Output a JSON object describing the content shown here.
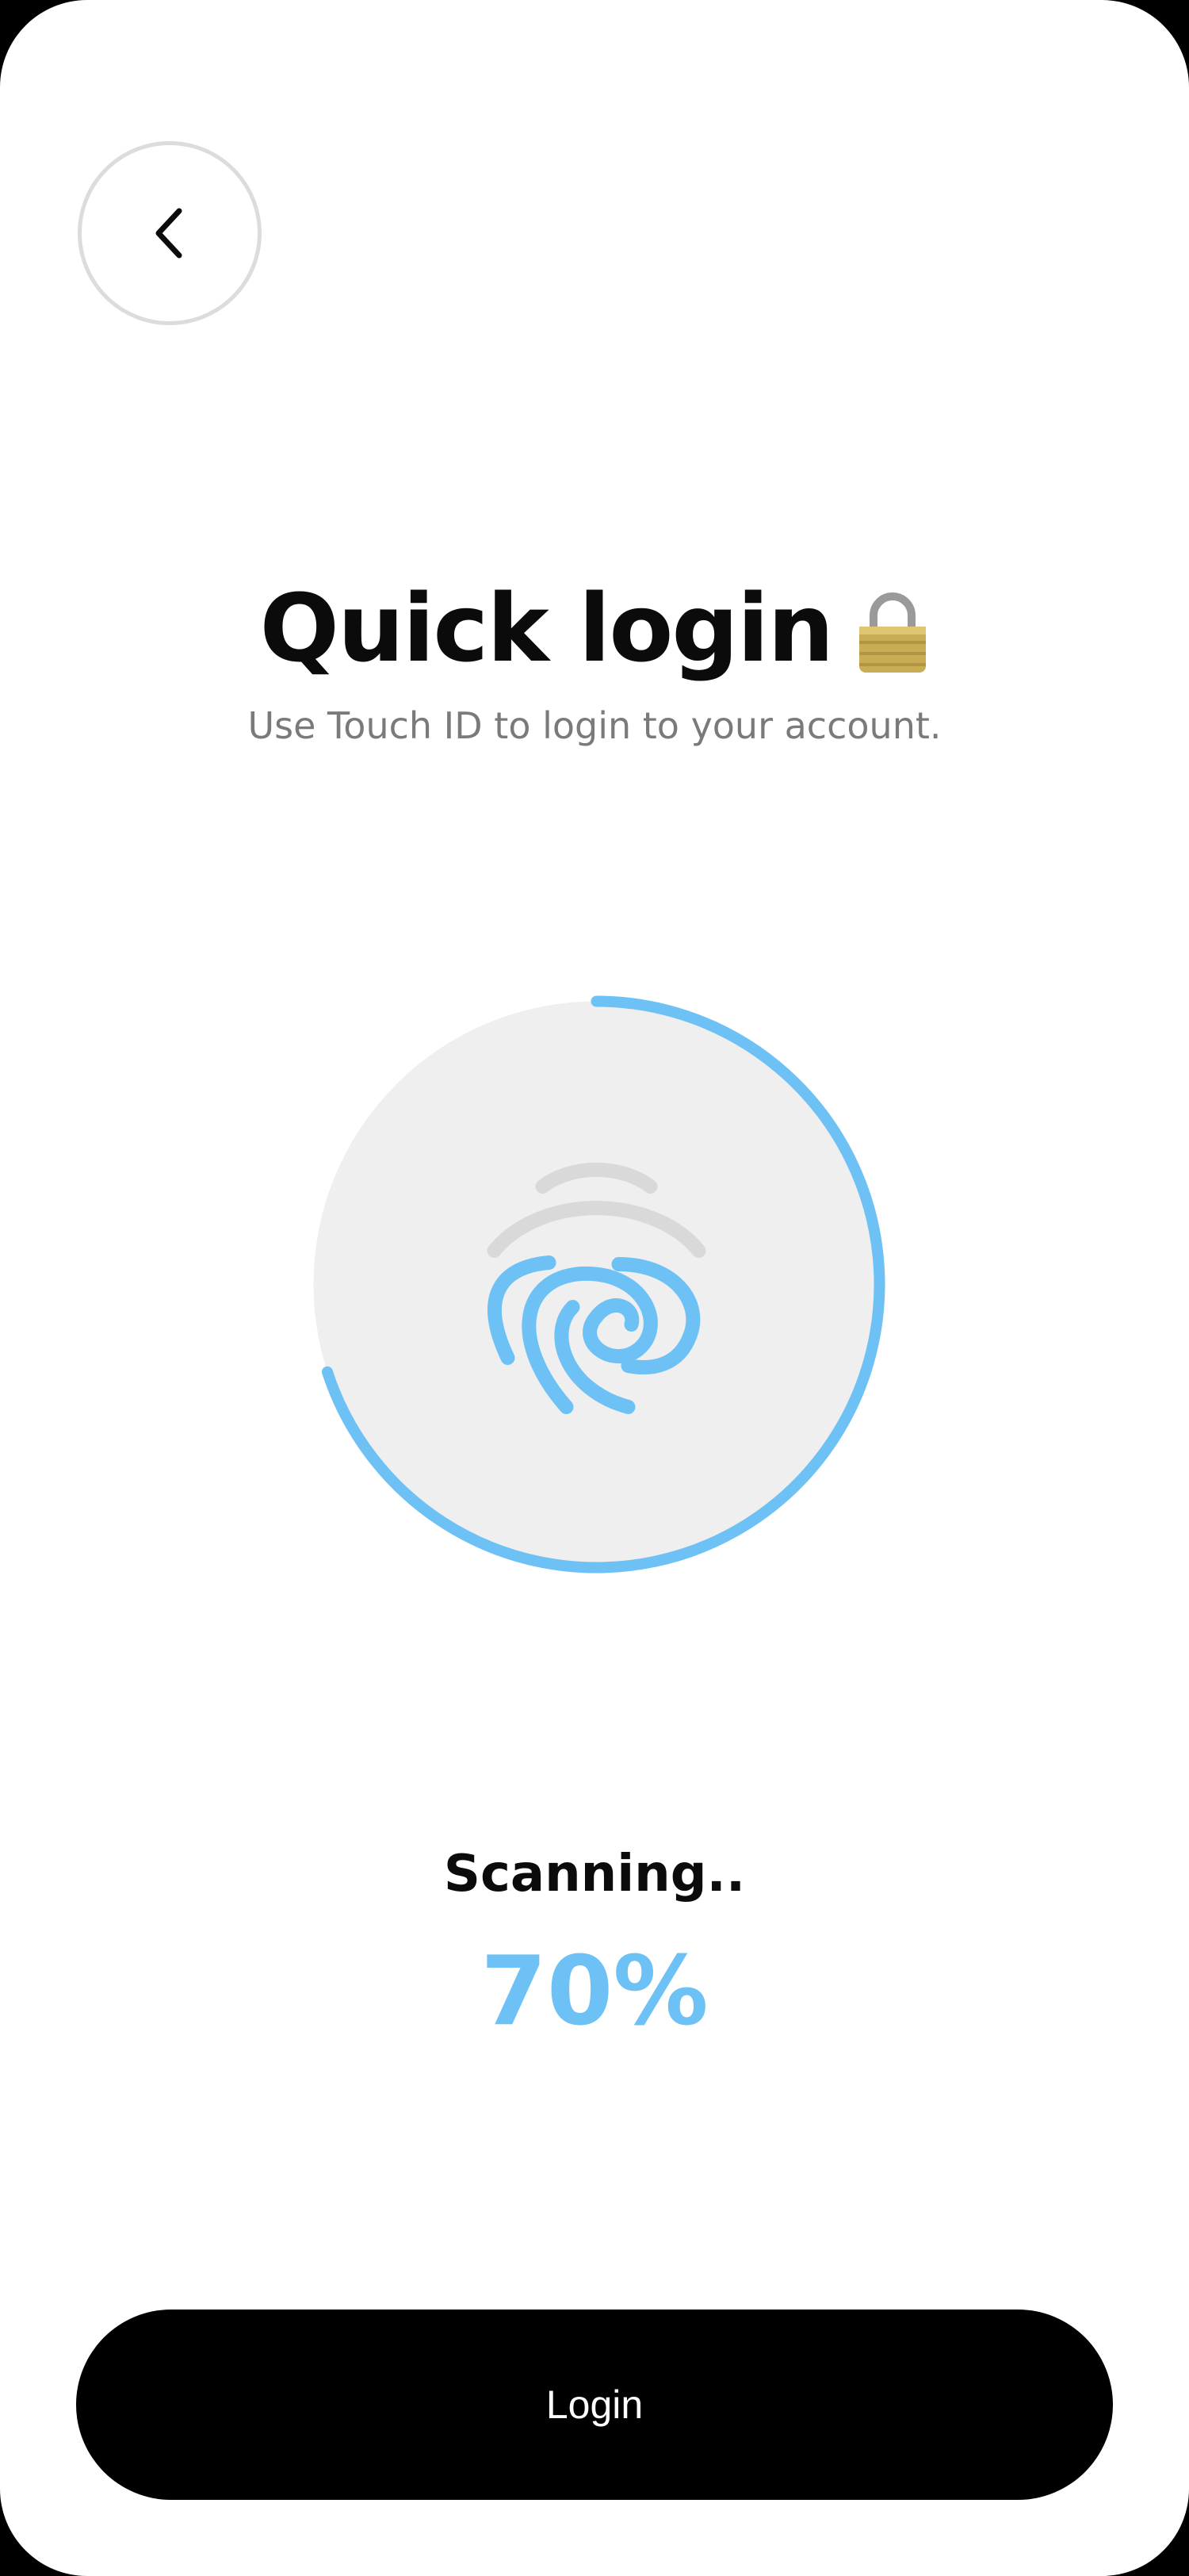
{
  "header": {
    "back_icon": "chevron-left-icon"
  },
  "main": {
    "title": "Quick login",
    "title_icon": "lock-icon",
    "subtitle": "Use Touch ID to login to your account.",
    "scanner_icon": "fingerprint-icon",
    "status": "Scanning..",
    "progress_label": "70%",
    "progress_value": 0.7
  },
  "footer": {
    "login_label": "Login"
  },
  "colors": {
    "accent": "#6ec1f5",
    "track": "#efefef",
    "inactive_ridge": "#d9d9d9",
    "button": "#000000"
  }
}
